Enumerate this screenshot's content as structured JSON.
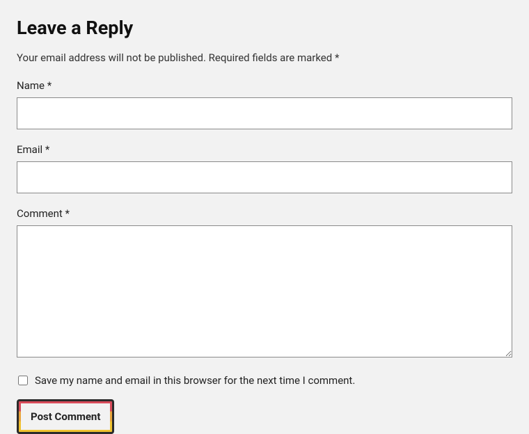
{
  "form": {
    "title": "Leave a Reply",
    "notice": "Your email address will not be published. Required fields are marked *",
    "fields": {
      "name": {
        "label": "Name *"
      },
      "email": {
        "label": "Email *"
      },
      "comment": {
        "label": "Comment *"
      }
    },
    "save_info": {
      "label": "Save my name and email in this browser for the next time I comment."
    },
    "submit": {
      "label": "Post Comment"
    }
  }
}
